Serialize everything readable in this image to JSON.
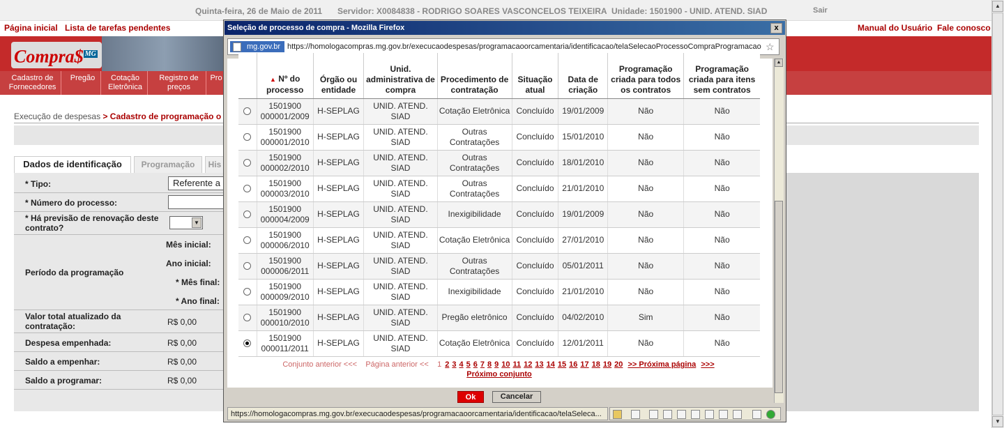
{
  "topbar": {
    "date": "Quinta-feira, 26 de Maio de 2011",
    "server": "Servidor: X0084838 - RODRIGO SOARES VASCONCELOS TEIXEIRA",
    "unit": "Unidade: 1501900 - UNID. ATEND. SIAD",
    "logout": "Sair"
  },
  "links": {
    "home": "Página inicial",
    "tasks": "Lista de tarefas pendentes",
    "manual": "Manual do Usuário",
    "contact": "Fale conosco"
  },
  "logo": {
    "text": "Compra$",
    "sub": "MG"
  },
  "nav": [
    "Cadastro de Fornecedores",
    "Pregão",
    "Cotação Eletrônica",
    "Registro de preços",
    "Pro"
  ],
  "breadcrumb": {
    "part1": "Execução de despesas",
    "part2": "> Cadastro de programação o"
  },
  "tabs": [
    "Dados de identificação",
    "Programação",
    "His"
  ],
  "form": {
    "tipo_label": "* Tipo:",
    "tipo_value": "Referente a c",
    "numero_label": "* Número do processo:",
    "renovacao_label": "* Há previsão de renovação deste contrato?",
    "periodo_label": "Período da programação",
    "mes_inicial": "Mês inicial:",
    "ano_inicial": "Ano inicial:",
    "mes_final": "* Mês final:",
    "ano_final": "* Ano final:",
    "valor_label": "Valor total atualizado da contratação:",
    "valor_value": "R$ 0,00",
    "despesa_label": "Despesa empenhada:",
    "despesa_value": "R$ 0,00",
    "saldo_emp_label": "Saldo a empenhar:",
    "saldo_emp_value": "R$ 0,00",
    "saldo_prog_label": "Saldo a programar:",
    "saldo_prog_value": "R$ 0,00"
  },
  "popup": {
    "title": "Seleção de processo de compra - Mozilla Firefox",
    "close": "x",
    "url_badge": "mg.gov.br",
    "url": "https://homologacompras.mg.gov.br/execucaodespesas/programacaoorcamentaria/identificacao/telaSelecaoProcessoCompraProgramacao.ht",
    "status_url": "https://homologacompras.mg.gov.br/execucaodespesas/programacaoorcamentaria/identificacao/telaSeleca...",
    "ok": "Ok",
    "cancel": "Cancelar",
    "star": "☆"
  },
  "table": {
    "headers": [
      "",
      "Nº do processo",
      "Órgão ou entidade",
      "Unid. administrativa de compra",
      "Procedimento de contratação",
      "Situação atual",
      "Data de criação",
      "Programação criada para todos os contratos",
      "Programação criada para itens sem contratos"
    ],
    "sort_arrow": "▲",
    "rows": [
      {
        "num": "1501900 000001/2009",
        "org": "H-SEPLAG",
        "unid": "UNID. ATEND. SIAD",
        "proc": "Cotação Eletrônica",
        "sit": "Concluído",
        "data": "19/01/2009",
        "todos": "Não",
        "itens": "Não",
        "selected": false
      },
      {
        "num": "1501900 000001/2010",
        "org": "H-SEPLAG",
        "unid": "UNID. ATEND. SIAD",
        "proc": "Outras Contratações",
        "sit": "Concluído",
        "data": "15/01/2010",
        "todos": "Não",
        "itens": "Não",
        "selected": false
      },
      {
        "num": "1501900 000002/2010",
        "org": "H-SEPLAG",
        "unid": "UNID. ATEND. SIAD",
        "proc": "Outras Contratações",
        "sit": "Concluído",
        "data": "18/01/2010",
        "todos": "Não",
        "itens": "Não",
        "selected": false
      },
      {
        "num": "1501900 000003/2010",
        "org": "H-SEPLAG",
        "unid": "UNID. ATEND. SIAD",
        "proc": "Outras Contratações",
        "sit": "Concluído",
        "data": "21/01/2010",
        "todos": "Não",
        "itens": "Não",
        "selected": false
      },
      {
        "num": "1501900 000004/2009",
        "org": "H-SEPLAG",
        "unid": "UNID. ATEND. SIAD",
        "proc": "Inexigibilidade",
        "sit": "Concluído",
        "data": "19/01/2009",
        "todos": "Não",
        "itens": "Não",
        "selected": false
      },
      {
        "num": "1501900 000006/2010",
        "org": "H-SEPLAG",
        "unid": "UNID. ATEND. SIAD",
        "proc": "Cotação Eletrônica",
        "sit": "Concluído",
        "data": "27/01/2010",
        "todos": "Não",
        "itens": "Não",
        "selected": false
      },
      {
        "num": "1501900 000006/2011",
        "org": "H-SEPLAG",
        "unid": "UNID. ATEND. SIAD",
        "proc": "Outras Contratações",
        "sit": "Concluído",
        "data": "05/01/2011",
        "todos": "Não",
        "itens": "Não",
        "selected": false
      },
      {
        "num": "1501900 000009/2010",
        "org": "H-SEPLAG",
        "unid": "UNID. ATEND. SIAD",
        "proc": "Inexigibilidade",
        "sit": "Concluído",
        "data": "21/01/2010",
        "todos": "Não",
        "itens": "Não",
        "selected": false
      },
      {
        "num": "1501900 000010/2010",
        "org": "H-SEPLAG",
        "unid": "UNID. ATEND. SIAD",
        "proc": "Pregão eletrônico",
        "sit": "Concluído",
        "data": "04/02/2010",
        "todos": "Sim",
        "itens": "Não",
        "selected": false
      },
      {
        "num": "1501900 000011/2011",
        "org": "H-SEPLAG",
        "unid": "UNID. ATEND. SIAD",
        "proc": "Cotação Eletrônica",
        "sit": "Concluído",
        "data": "12/01/2011",
        "todos": "Não",
        "itens": "Não",
        "selected": true
      }
    ]
  },
  "pager": {
    "prev_set": "Conjunto anterior <<<",
    "prev_page": "Página anterior <<",
    "current": "1",
    "pages": [
      "2",
      "3",
      "4",
      "5",
      "6",
      "7",
      "8",
      "9",
      "10",
      "11",
      "12",
      "13",
      "14",
      "15",
      "16",
      "17",
      "18",
      "19",
      "20"
    ],
    "next_page": ">> Próxima página",
    "next_arrows": ">>>",
    "next_set": "Próximo conjunto"
  }
}
